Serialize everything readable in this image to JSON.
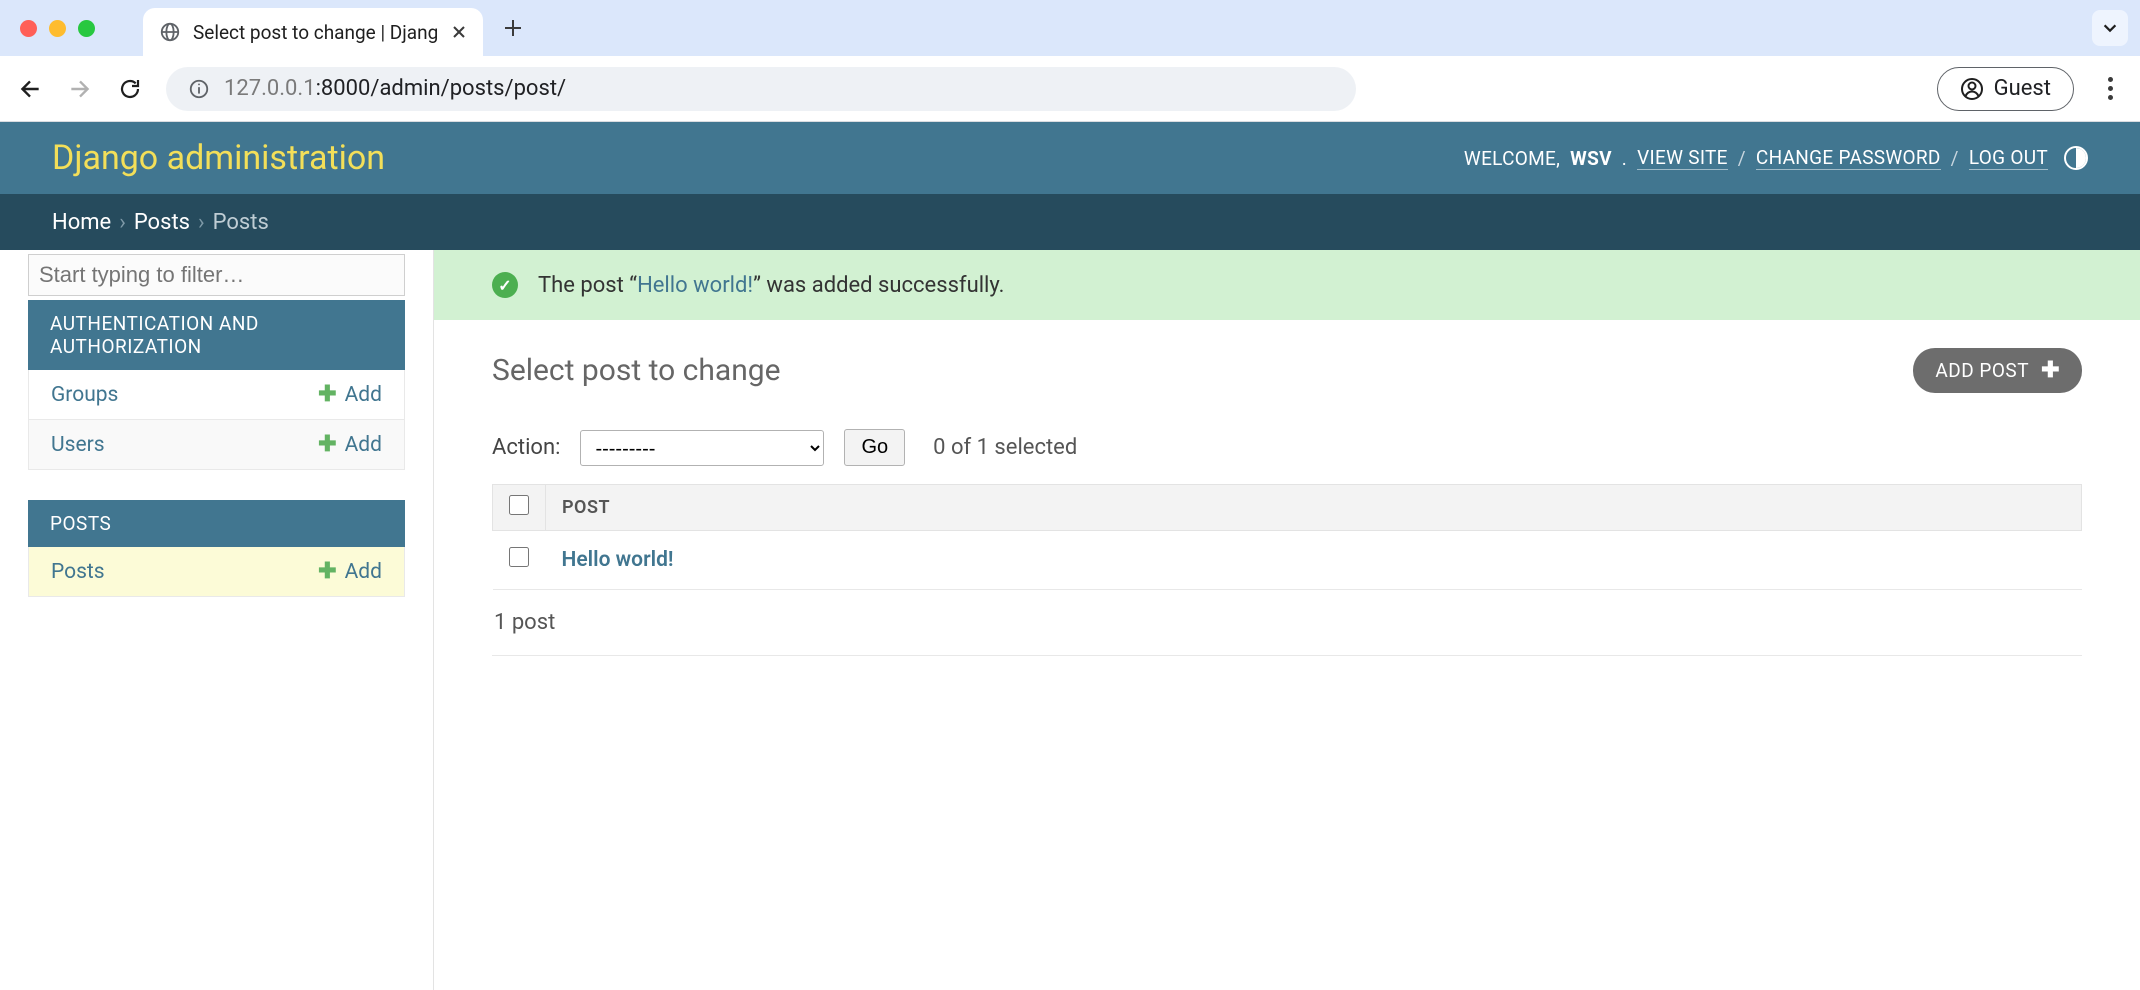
{
  "browser": {
    "tab_title": "Select post to change | Djang",
    "url_dim": "127.0.0.1",
    "url_rest": ":8000/admin/posts/post/",
    "guest_label": "Guest"
  },
  "header": {
    "brand": "Django administration",
    "welcome": "WELCOME,",
    "user": "WSV",
    "view_site": "VIEW SITE",
    "change_password": "CHANGE PASSWORD",
    "log_out": "LOG OUT"
  },
  "breadcrumbs": {
    "home": "Home",
    "posts_app": "Posts",
    "posts_model": "Posts"
  },
  "sidebar": {
    "filter_placeholder": "Start typing to filter…",
    "apps": [
      {
        "caption": "AUTHENTICATION AND AUTHORIZATION",
        "models": [
          {
            "label": "Groups",
            "add": "Add"
          },
          {
            "label": "Users",
            "add": "Add"
          }
        ]
      },
      {
        "caption": "POSTS",
        "models": [
          {
            "label": "Posts",
            "add": "Add"
          }
        ]
      }
    ]
  },
  "message": {
    "pre": "The post “",
    "link": "Hello world!",
    "post": "” was added successfully."
  },
  "main": {
    "title": "Select post to change",
    "add_btn": "ADD POST",
    "action_label": "Action:",
    "action_placeholder": "---------",
    "go": "Go",
    "selection_text": "0 of 1 selected",
    "col_header": "POST",
    "rows": [
      {
        "name": "Hello world!"
      }
    ],
    "count_text": "1 post"
  }
}
